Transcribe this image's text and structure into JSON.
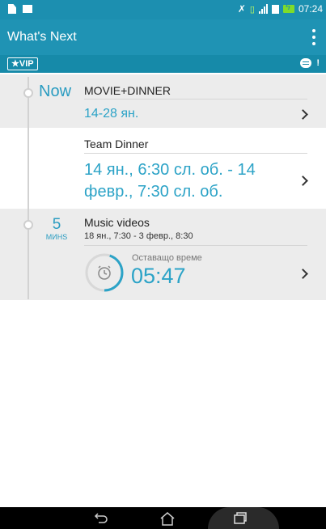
{
  "status_bar": {
    "time": "07:24",
    "icons": [
      "document-icon",
      "message-icon",
      "mute-icon",
      "sim-icon",
      "signal-icon",
      "data-icon",
      "battery-charging-icon"
    ]
  },
  "app_bar": {
    "title": "What's Next",
    "menu_icon": "overflow-menu-icon"
  },
  "vip_bar": {
    "vip_label": "VIP",
    "alert_mark": "!"
  },
  "timeline": {
    "now_label": "Now",
    "events": [
      {
        "title": "MOVIE+DINNER",
        "time": "14-28 ян."
      },
      {
        "title": "Team Dinner",
        "time_line1": "14 ян., 6:30 сл. об. - 14",
        "time_line2": "февр., 7:30 сл. об."
      },
      {
        "countdown_number": "5",
        "countdown_unit": "МИНS",
        "title": "Music videos",
        "subtitle": "18 ян., 7:30 - 3 февр., 8:30",
        "remaining_label": "Оставащо време",
        "remaining_time": "05:47",
        "progress": 0.45
      }
    ]
  },
  "colors": {
    "accent": "#2ca3c7",
    "app_bar": "#1f93b4",
    "vip_bar": "#168aa9",
    "status_bar": "#1c8fb0"
  },
  "nav_bar": {
    "icons": [
      "back-icon",
      "home-icon",
      "recent-apps-icon"
    ]
  }
}
